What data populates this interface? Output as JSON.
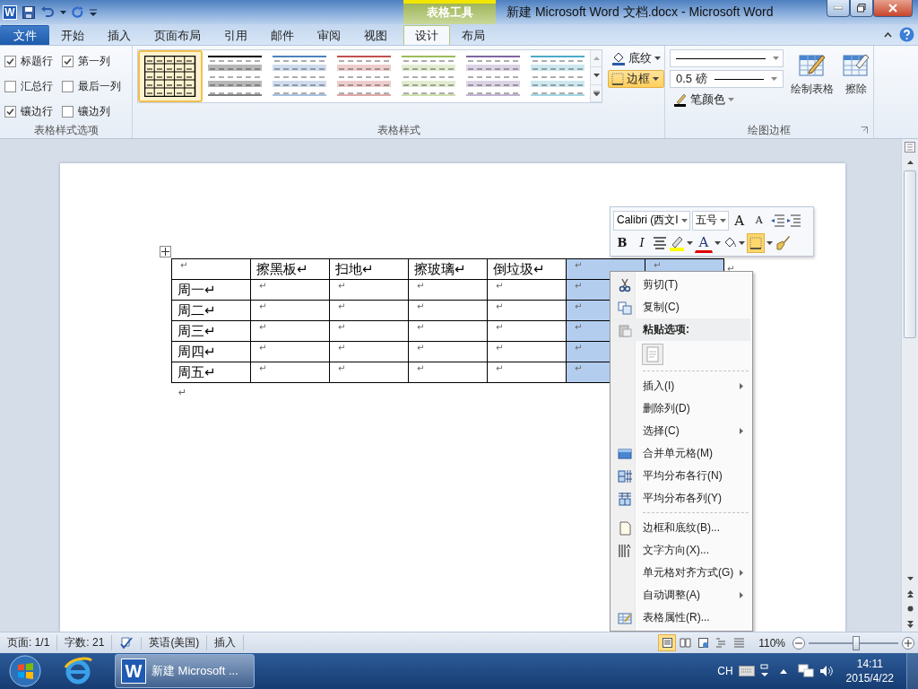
{
  "window": {
    "app_icon": "W",
    "context_group": "表格工具",
    "title": "新建 Microsoft Word 文档.docx - Microsoft Word"
  },
  "tabs": [
    {
      "label": "文件",
      "kind": "file",
      "selected": false
    },
    {
      "label": "开始",
      "kind": "tab",
      "selected": false
    },
    {
      "label": "插入",
      "kind": "tab",
      "selected": false
    },
    {
      "label": "页面布局",
      "kind": "tab",
      "selected": false
    },
    {
      "label": "引用",
      "kind": "tab",
      "selected": false
    },
    {
      "label": "邮件",
      "kind": "tab",
      "selected": false
    },
    {
      "label": "审阅",
      "kind": "tab",
      "selected": false
    },
    {
      "label": "视图",
      "kind": "tab",
      "selected": false
    },
    {
      "label": "设计",
      "kind": "context",
      "selected": true
    },
    {
      "label": "布局",
      "kind": "context",
      "selected": false
    }
  ],
  "style_options": {
    "label": "表格样式选项",
    "items": [
      {
        "label": "标题行",
        "checked": true
      },
      {
        "label": "第一列",
        "checked": true
      },
      {
        "label": "汇总行",
        "checked": false
      },
      {
        "label": "最后一列",
        "checked": false
      },
      {
        "label": "镶边行",
        "checked": true
      },
      {
        "label": "镶边列",
        "checked": false
      }
    ]
  },
  "table_styles": {
    "label": "表格样式",
    "items": [
      {
        "kind": "grid",
        "color": "#000000",
        "selected": true
      },
      {
        "kind": "banded",
        "color": "#000000",
        "selected": false
      },
      {
        "kind": "banded",
        "color": "#4f81bd",
        "selected": false
      },
      {
        "kind": "banded",
        "color": "#c0504d",
        "selected": false
      },
      {
        "kind": "banded",
        "color": "#9bbb59",
        "selected": false
      },
      {
        "kind": "banded",
        "color": "#8064a2",
        "selected": false
      },
      {
        "kind": "banded",
        "color": "#4bacc6",
        "selected": false
      }
    ],
    "shading": {
      "label": "底纹",
      "selected": false
    },
    "borders": {
      "label": "边框",
      "selected": true
    }
  },
  "draw_borders": {
    "label": "绘图边框",
    "line_weight": "0.5 磅",
    "pen_color": "笔颜色",
    "draw_table": "绘制表格",
    "eraser": "擦除"
  },
  "mini_toolbar": {
    "font": "Calibri (西文I",
    "size": "五号",
    "grow": "A",
    "shrink": "A",
    "bold": "B",
    "italic": "I",
    "font_color": "A",
    "border_selected": true
  },
  "table": {
    "rows": [
      {
        "end_mark": "↵",
        "cells": [
          {
            "text": "↵",
            "selected": false
          },
          {
            "text": "擦黑板↵",
            "selected": false
          },
          {
            "text": "扫地↵",
            "selected": false
          },
          {
            "text": "擦玻璃↵",
            "selected": false
          },
          {
            "text": "倒垃圾↵",
            "selected": false
          },
          {
            "text": "↵",
            "selected": true
          },
          {
            "text": "↵",
            "selected": true
          }
        ]
      },
      {
        "cells": [
          {
            "text": "周一↵",
            "selected": false
          },
          {
            "text": "↵",
            "selected": false
          },
          {
            "text": "↵",
            "selected": false
          },
          {
            "text": "↵",
            "selected": false
          },
          {
            "text": "↵",
            "selected": false
          },
          {
            "text": "↵",
            "selected": true
          }
        ]
      },
      {
        "cells": [
          {
            "text": "周二↵",
            "selected": false
          },
          {
            "text": "↵",
            "selected": false
          },
          {
            "text": "↵",
            "selected": false
          },
          {
            "text": "↵",
            "selected": false
          },
          {
            "text": "↵",
            "selected": false
          },
          {
            "text": "↵",
            "selected": true
          }
        ]
      },
      {
        "cells": [
          {
            "text": "周三↵",
            "selected": false
          },
          {
            "text": "↵",
            "selected": false
          },
          {
            "text": "↵",
            "selected": false
          },
          {
            "text": "↵",
            "selected": false
          },
          {
            "text": "↵",
            "selected": false
          },
          {
            "text": "↵",
            "selected": true
          }
        ]
      },
      {
        "cells": [
          {
            "text": "周四↵",
            "selected": false
          },
          {
            "text": "↵",
            "selected": false
          },
          {
            "text": "↵",
            "selected": false
          },
          {
            "text": "↵",
            "selected": false
          },
          {
            "text": "↵",
            "selected": false
          },
          {
            "text": "↵",
            "selected": true
          }
        ]
      },
      {
        "cells": [
          {
            "text": "周五↵",
            "selected": false
          },
          {
            "text": "↵",
            "selected": false
          },
          {
            "text": "↵",
            "selected": false
          },
          {
            "text": "↵",
            "selected": false
          },
          {
            "text": "↵",
            "selected": false
          },
          {
            "text": "↵",
            "selected": true
          }
        ]
      }
    ],
    "after_mark": "↵"
  },
  "context_menu": [
    {
      "kind": "cut",
      "label": "剪切(T)"
    },
    {
      "kind": "copy",
      "label": "复制(C)"
    },
    {
      "kind": "header",
      "label": "粘贴选项:"
    },
    {
      "kind": "paste"
    },
    {
      "kind": "separator"
    },
    {
      "kind": "submenu",
      "label": "插入(I)"
    },
    {
      "kind": "plain",
      "label": "删除列(D)"
    },
    {
      "kind": "submenu",
      "label": "选择(C)"
    },
    {
      "kind": "merge",
      "label": "合并单元格(M)"
    },
    {
      "kind": "rows",
      "label": "平均分布各行(N)"
    },
    {
      "kind": "cols",
      "label": "平均分布各列(Y)"
    },
    {
      "kind": "separator"
    },
    {
      "kind": "borders",
      "label": "边框和底纹(B)..."
    },
    {
      "kind": "direction",
      "label": "文字方向(X)..."
    },
    {
      "kind": "submenu",
      "label": "单元格对齐方式(G)"
    },
    {
      "kind": "submenu",
      "label": "自动调整(A)"
    },
    {
      "kind": "properties",
      "label": "表格属性(R)..."
    }
  ],
  "status_bar": {
    "page": "页面: 1/1",
    "words": "字数: 21",
    "language": "英语(美国)",
    "mode": "插入",
    "zoom": "110%",
    "zoom_slider": {
      "level": 0.53
    },
    "views": [
      {
        "kind": "print",
        "selected": true
      },
      {
        "kind": "reading",
        "selected": false
      },
      {
        "kind": "web",
        "selected": false
      },
      {
        "kind": "outline",
        "selected": false
      },
      {
        "kind": "draft",
        "selected": false
      }
    ]
  },
  "taskbar": {
    "app_icon": "W",
    "task": "新建 Microsoft ...",
    "language": "CH",
    "time": "14:11",
    "date": "2015/4/22"
  }
}
